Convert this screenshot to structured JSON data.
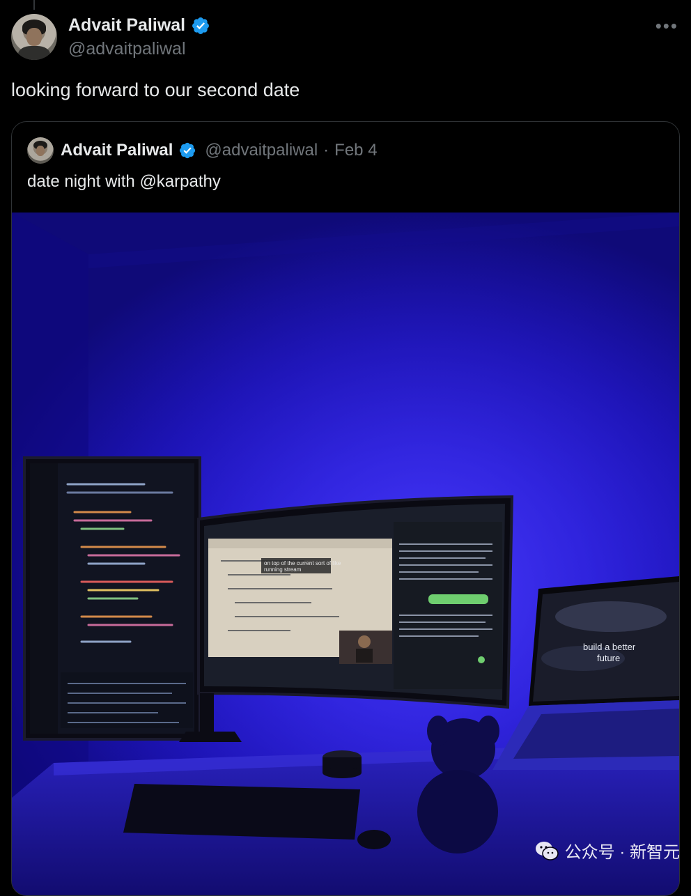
{
  "tweet": {
    "display_name": "Advait Paliwal",
    "handle": "@advaitpaliwal",
    "text": "looking forward to our second date",
    "more_icon": "more-horizontal-icon",
    "more_label": "•••"
  },
  "quote": {
    "display_name": "Advait Paliwal",
    "handle": "@advaitpaliwal",
    "separator": "·",
    "date": "Feb 4",
    "text": "date night with @karpathy",
    "image_alt": "Desk setup lit in blue with a vertical monitor, a curved monitor and a laptop",
    "monitor_caption_1": "on top of the current sort of like",
    "monitor_caption_2": "running stream",
    "laptop_text_1": "build a better",
    "laptop_text_2": "future"
  },
  "watermark": {
    "icon": "wechat-icon",
    "text": "公众号 · 新智元"
  },
  "colors": {
    "background": "#000000",
    "text_primary": "#e7e9ea",
    "text_secondary": "#71767b",
    "verified_blue": "#1d9bf0",
    "border": "#2f3336",
    "wall_blue": "#2a1fe6"
  }
}
